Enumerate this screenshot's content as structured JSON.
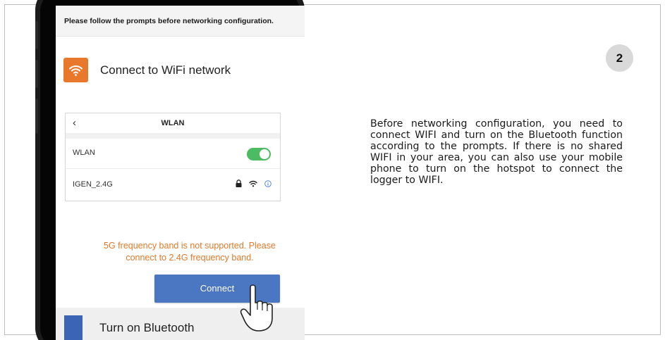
{
  "prompt": {
    "text": "Please follow the prompts before networking configuration."
  },
  "step": {
    "title": "Connect to WiFi network",
    "icon": "wifi-icon",
    "accent_color": "#e8792c"
  },
  "wlan_settings": {
    "back_icon": "chevron-left-icon",
    "title": "WLAN",
    "toggle": {
      "label": "WLAN",
      "state": "on",
      "color": "#4cbb62"
    },
    "network": {
      "ssid": "IGEN_2.4G",
      "icons": [
        "lock-icon",
        "wifi-signal-icon",
        "info-icon"
      ]
    }
  },
  "warning": {
    "line1": "5G frequency band is not supported. Please",
    "line2": "connect to 2.4G frequency band.",
    "color": "#e07a2a"
  },
  "connect_button": {
    "label": "Connect",
    "color": "#4a76c2"
  },
  "next_step": {
    "title": "Turn on Bluetooth",
    "accent_color": "#3b63b6"
  },
  "step_badge": "2",
  "description": "Before networking configuration, you need to connect WIFI and turn on the Bluetooth function according to the prompts. If there is no shared WIFI in your area, you can also use your mobile phone to turn on the hotspot to connect the logger to WIFI."
}
